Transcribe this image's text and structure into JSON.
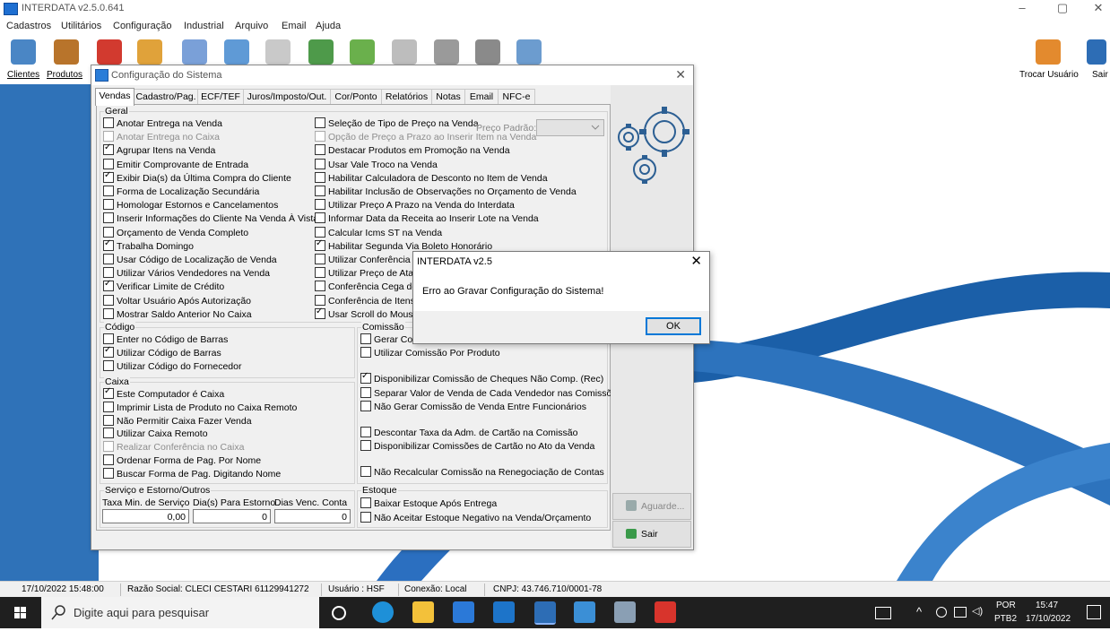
{
  "window": {
    "title": "INTERDATA v2.5.0.641",
    "minimize": "–",
    "maximize": "▢",
    "close": "✕"
  },
  "menu": [
    "Cadastros",
    "Utilitários",
    "Configuração",
    "Industrial",
    "Arquivo",
    "Email",
    "Ajuda"
  ],
  "toolbar": {
    "clientes": "Clientes",
    "produtos": "Produtos",
    "trocar_usuario": "Trocar Usuário",
    "sair": "Sair"
  },
  "config_dialog": {
    "title": "Configuração do Sistema",
    "close": "✕",
    "tabs": [
      "Vendas",
      "Cadastro/Pag.",
      "ECF/TEF",
      "Juros/Imposto/Out.",
      "Cor/Ponto",
      "Relatórios",
      "Notas",
      "Email",
      "NFC-e"
    ],
    "geral": {
      "title": "Geral",
      "left": [
        {
          "label": "Anotar Entrega na Venda",
          "checked": false,
          "disabled": false
        },
        {
          "label": "Anotar Entrega no Caixa",
          "checked": false,
          "disabled": true
        },
        {
          "label": "Agrupar Itens na Venda",
          "checked": true,
          "disabled": false
        },
        {
          "label": "Emitir Comprovante de Entrada",
          "checked": false,
          "disabled": false
        },
        {
          "label": "Exibir Dia(s) da Última Compra do Cliente",
          "checked": true,
          "disabled": false
        },
        {
          "label": "Forma de Localização Secundária",
          "checked": false,
          "disabled": false
        },
        {
          "label": "Homologar Estornos e Cancelamentos",
          "checked": false,
          "disabled": false
        },
        {
          "label": "Inserir Informações do Cliente Na Venda À Vista",
          "checked": false,
          "disabled": false
        },
        {
          "label": "Orçamento de Venda Completo",
          "checked": false,
          "disabled": false
        },
        {
          "label": "Trabalha Domingo",
          "checked": true,
          "disabled": false
        },
        {
          "label": "Usar Código de Localização de Venda",
          "checked": false,
          "disabled": false
        },
        {
          "label": "Utilizar Vários Vendedores na Venda",
          "checked": false,
          "disabled": false
        },
        {
          "label": "Verificar Limite de Crédito",
          "checked": true,
          "disabled": false
        },
        {
          "label": "Voltar Usuário Após Autorização",
          "checked": false,
          "disabled": false
        },
        {
          "label": "Mostrar Saldo Anterior No Caixa",
          "checked": false,
          "disabled": false
        }
      ],
      "right": [
        {
          "label": "Seleção de Tipo de Preço na Venda",
          "checked": false,
          "disabled": false
        },
        {
          "label": "Opção de Preço a Prazo ao Inserir Item na Venda",
          "checked": false,
          "disabled": true
        },
        {
          "label": "Destacar Produtos em Promoção na Venda",
          "checked": false,
          "disabled": false
        },
        {
          "label": "Usar Vale Troco na Venda",
          "checked": false,
          "disabled": false
        },
        {
          "label": "Habilitar Calculadora de Desconto no Item de Venda",
          "checked": false,
          "disabled": false
        },
        {
          "label": "Habilitar Inclusão de Observações no Orçamento de Venda",
          "checked": false,
          "disabled": false
        },
        {
          "label": "Utilizar Preço A Prazo na Venda do Interdata",
          "checked": false,
          "disabled": false
        },
        {
          "label": "Informar Data da Receita ao Inserir Lote na Venda",
          "checked": false,
          "disabled": false
        },
        {
          "label": "Calcular Icms ST na Venda",
          "checked": false,
          "disabled": false
        },
        {
          "label": "Habilitar Segunda Via Boleto Honorário",
          "checked": true,
          "disabled": false
        },
        {
          "label": "Utilizar Conferência de",
          "checked": false,
          "disabled": false
        },
        {
          "label": "Utilizar Preço de Ataca",
          "checked": false,
          "disabled": false
        },
        {
          "label": "Conferência Cega de E",
          "checked": false,
          "disabled": false
        },
        {
          "label": "Conferência de Itens n",
          "checked": false,
          "disabled": false
        },
        {
          "label": "Usar Scroll do Mouse p",
          "checked": true,
          "disabled": false
        }
      ],
      "preco_padrao_label": "Preço Padrão:"
    },
    "codigo": {
      "title": "Código",
      "items": [
        {
          "label": "Enter no Código de Barras",
          "checked": false
        },
        {
          "label": "Utilizar Código de Barras",
          "checked": true
        },
        {
          "label": "Utilizar Código do Fornecedor",
          "checked": false
        }
      ]
    },
    "caixa": {
      "title": "Caixa",
      "items": [
        {
          "label": "Este Computador é Caixa",
          "checked": true,
          "disabled": false
        },
        {
          "label": "Imprimir Lista de Produto no Caixa Remoto",
          "checked": false,
          "disabled": false
        },
        {
          "label": "Não Permitir Caixa Fazer Venda",
          "checked": false,
          "disabled": false
        },
        {
          "label": "Utilizar Caixa Remoto",
          "checked": false,
          "disabled": false
        },
        {
          "label": "Realizar Conferência no Caixa",
          "checked": false,
          "disabled": true
        },
        {
          "label": "Ordenar Forma de Pag. Por Nome",
          "checked": false,
          "disabled": false
        },
        {
          "label": "Buscar Forma de Pag. Digitando Nome",
          "checked": false,
          "disabled": false
        }
      ]
    },
    "comissao": {
      "title": "Comissão",
      "items": [
        {
          "label": "Gerar Com",
          "checked": false
        },
        {
          "label": "Utilizar Comissão Por Produto",
          "checked": false
        },
        {
          "label": "Disponibilizar Comissão de Cheques Não Comp. (Rec)",
          "checked": true
        },
        {
          "label": "Separar Valor de Venda de Cada Vendedor nas Comissões",
          "checked": false
        },
        {
          "label": "Não Gerar Comissão de Venda Entre Funcionários",
          "checked": false
        },
        {
          "label": "Descontar Taxa da Adm. de Cartão na Comissão",
          "checked": false
        },
        {
          "label": "Disponibilizar Comissões de Cartão no Ato da Venda",
          "checked": false
        },
        {
          "label": "Não Recalcular Comissão na Renegociação de Contas",
          "checked": false
        }
      ]
    },
    "servico": {
      "title": "Serviço e Estorno/Outros",
      "taxa_label": "Taxa Min. de Serviço",
      "taxa_value": "0,00",
      "dias_estorno_label": "Dia(s) Para Estorno",
      "dias_estorno_value": "0",
      "dias_venc_label": "Dias Venc. Conta",
      "dias_venc_value": "0"
    },
    "estoque": {
      "title": "Estoque",
      "items": [
        {
          "label": "Baixar Estoque Após Entrega",
          "checked": false
        },
        {
          "label": "Não Aceitar Estoque Negativo na Venda/Orçamento",
          "checked": false
        }
      ]
    },
    "buttons": {
      "aguarde": "Aguarde...",
      "sair": "Sair"
    }
  },
  "alert": {
    "title": "INTERDATA v2.5",
    "message": "Erro ao Gravar Configuração do Sistema!",
    "ok": "OK",
    "close": "✕"
  },
  "statusbar": {
    "datetime": "17/10/2022 15:48:00",
    "razao": "Razão Social: CLECI CESTARI 61129941272",
    "usuario": "Usuário : HSF",
    "conexao": "Conexão: Local",
    "cnpj": "CNPJ: 43.746.710/0001-78"
  },
  "taskbar": {
    "search_placeholder": "Digite aqui para pesquisar",
    "lang_top": "POR",
    "lang_bottom": "PTB2",
    "time": "15:47",
    "date": "17/10/2022"
  }
}
